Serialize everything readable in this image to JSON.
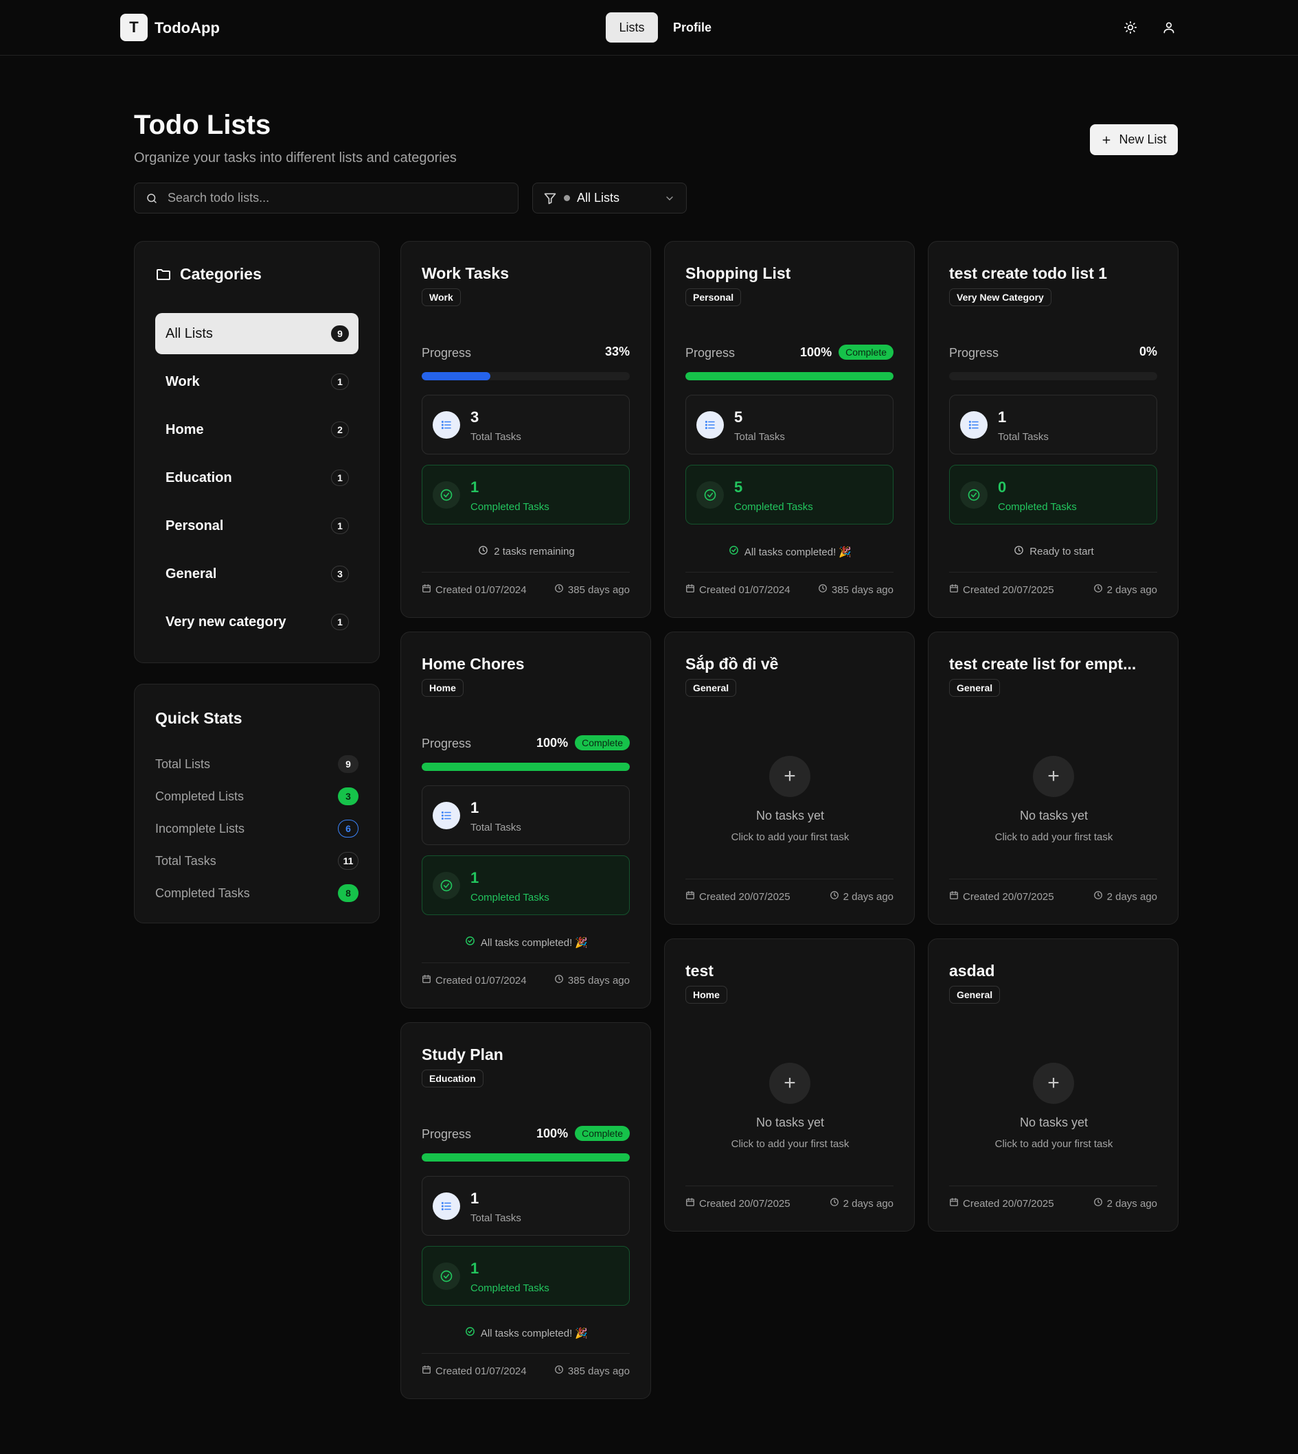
{
  "app": {
    "logo_letter": "T",
    "name": "TodoApp"
  },
  "nav": {
    "lists": "Lists",
    "profile": "Profile"
  },
  "header": {
    "title": "Todo Lists",
    "subtitle": "Organize your tasks into different lists and categories",
    "new_list": "New List"
  },
  "search": {
    "placeholder": "Search todo lists..."
  },
  "filter": {
    "value": "All Lists"
  },
  "categories": {
    "title": "Categories",
    "items": [
      {
        "label": "All Lists",
        "count": "9"
      },
      {
        "label": "Work",
        "count": "1"
      },
      {
        "label": "Home",
        "count": "2"
      },
      {
        "label": "Education",
        "count": "1"
      },
      {
        "label": "Personal",
        "count": "1"
      },
      {
        "label": "General",
        "count": "3"
      },
      {
        "label": "Very new category",
        "count": "1"
      }
    ]
  },
  "quick_stats": {
    "title": "Quick Stats",
    "rows": [
      {
        "label": "Total Lists",
        "value": "9"
      },
      {
        "label": "Completed Lists",
        "value": "3"
      },
      {
        "label": "Incomplete Lists",
        "value": "6"
      },
      {
        "label": "Total Tasks",
        "value": "11"
      },
      {
        "label": "Completed Tasks",
        "value": "8"
      }
    ]
  },
  "common": {
    "progress_label": "Progress",
    "complete_pill": "Complete",
    "total_tasks_label": "Total Tasks",
    "completed_tasks_label": "Completed Tasks",
    "no_tasks": "No tasks yet",
    "no_tasks_sub": "Click to add your first task"
  },
  "lists": [
    {
      "title": "Work Tasks",
      "tag": "Work",
      "progress_text": "33%",
      "progress": 0.33,
      "complete": false,
      "total": "3",
      "completed": "1",
      "note": "2 tasks remaining",
      "created": "Created 01/07/2024",
      "ago": "385 days ago"
    },
    {
      "title": "Shopping List",
      "tag": "Personal",
      "progress_text": "100%",
      "progress": 1.0,
      "complete": true,
      "total": "5",
      "completed": "5",
      "note": "All tasks completed! 🎉",
      "created": "Created 01/07/2024",
      "ago": "385 days ago"
    },
    {
      "title": "test create todo list 1",
      "tag": "Very New Category",
      "progress_text": "0%",
      "progress": 0,
      "complete": false,
      "total": "1",
      "completed": "0",
      "note": "Ready to start",
      "created": "Created 20/07/2025",
      "ago": "2 days ago"
    },
    {
      "title": "Home Chores",
      "tag": "Home",
      "progress_text": "100%",
      "progress": 1.0,
      "complete": true,
      "total": "1",
      "completed": "1",
      "note": "All tasks completed! 🎉",
      "created": "Created 01/07/2024",
      "ago": "385 days ago"
    },
    {
      "title": "Sắp đồ đi về",
      "tag": "General",
      "created": "Created 20/07/2025",
      "ago": "2 days ago"
    },
    {
      "title": "test create list for empt...",
      "tag": "General",
      "created": "Created 20/07/2025",
      "ago": "2 days ago"
    },
    {
      "title": "Study Plan",
      "tag": "Education",
      "progress_text": "100%",
      "progress": 1.0,
      "complete": true,
      "total": "1",
      "completed": "1",
      "note": "All tasks completed! 🎉",
      "created": "Created 01/07/2024",
      "ago": "385 days ago"
    },
    {
      "title": "test",
      "tag": "Home",
      "created": "Created 20/07/2025",
      "ago": "2 days ago"
    },
    {
      "title": "asdad",
      "tag": "General",
      "created": "Created 20/07/2025",
      "ago": "2 days ago"
    }
  ],
  "colors": {
    "progress_partial": "#2563eb",
    "progress_complete": "#16c24a",
    "accent_green": "#22c55e",
    "accent_blue": "#3b82f6"
  }
}
